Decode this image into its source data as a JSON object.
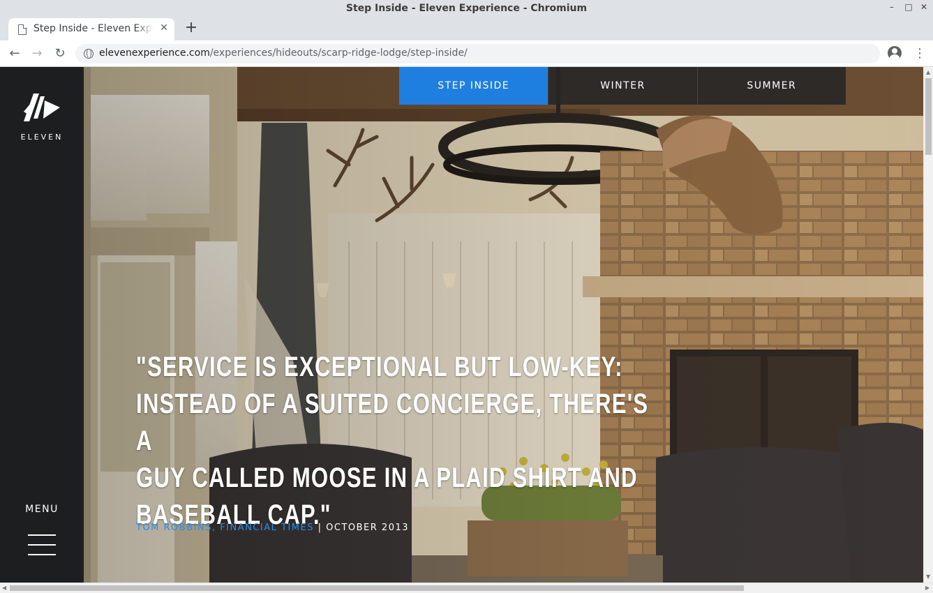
{
  "window": {
    "title": "Step Inside - Eleven Experience - Chromium",
    "controls": [
      "–",
      "□",
      "✕"
    ]
  },
  "tab": {
    "title": "Step Inside - Eleven Experience",
    "close": "✕"
  },
  "new_tab": "+",
  "nav": {
    "back": "←",
    "forward": "→",
    "reload": "↻",
    "menu": "⋮"
  },
  "address": {
    "domain": "elevenexperience.com",
    "path": "/experiences/hideouts/scarp-ridge-lodge/step-inside/"
  },
  "sidebar": {
    "logo_text": "ELEVEN",
    "menu_label": "MENU"
  },
  "subnav": {
    "items": [
      "STEP INSIDE",
      "WINTER",
      "SUMMER"
    ],
    "active_index": 0
  },
  "quote": {
    "lines": [
      "\"SERVICE IS EXCEPTIONAL BUT LOW-KEY:",
      "INSTEAD OF A SUITED CONCIERGE, THERE'S A",
      "GUY CALLED MOOSE IN A PLAID SHIRT AND",
      "BASEBALL CAP.\""
    ],
    "author": "TOM ROBBINS, FINANCIAL TIMES",
    "separator": " | ",
    "date": "OCTOBER 2013"
  },
  "colors": {
    "accent": "#1f7fe0",
    "author_link": "#2a8de8",
    "sidebar_bg": "#1d1e20"
  }
}
